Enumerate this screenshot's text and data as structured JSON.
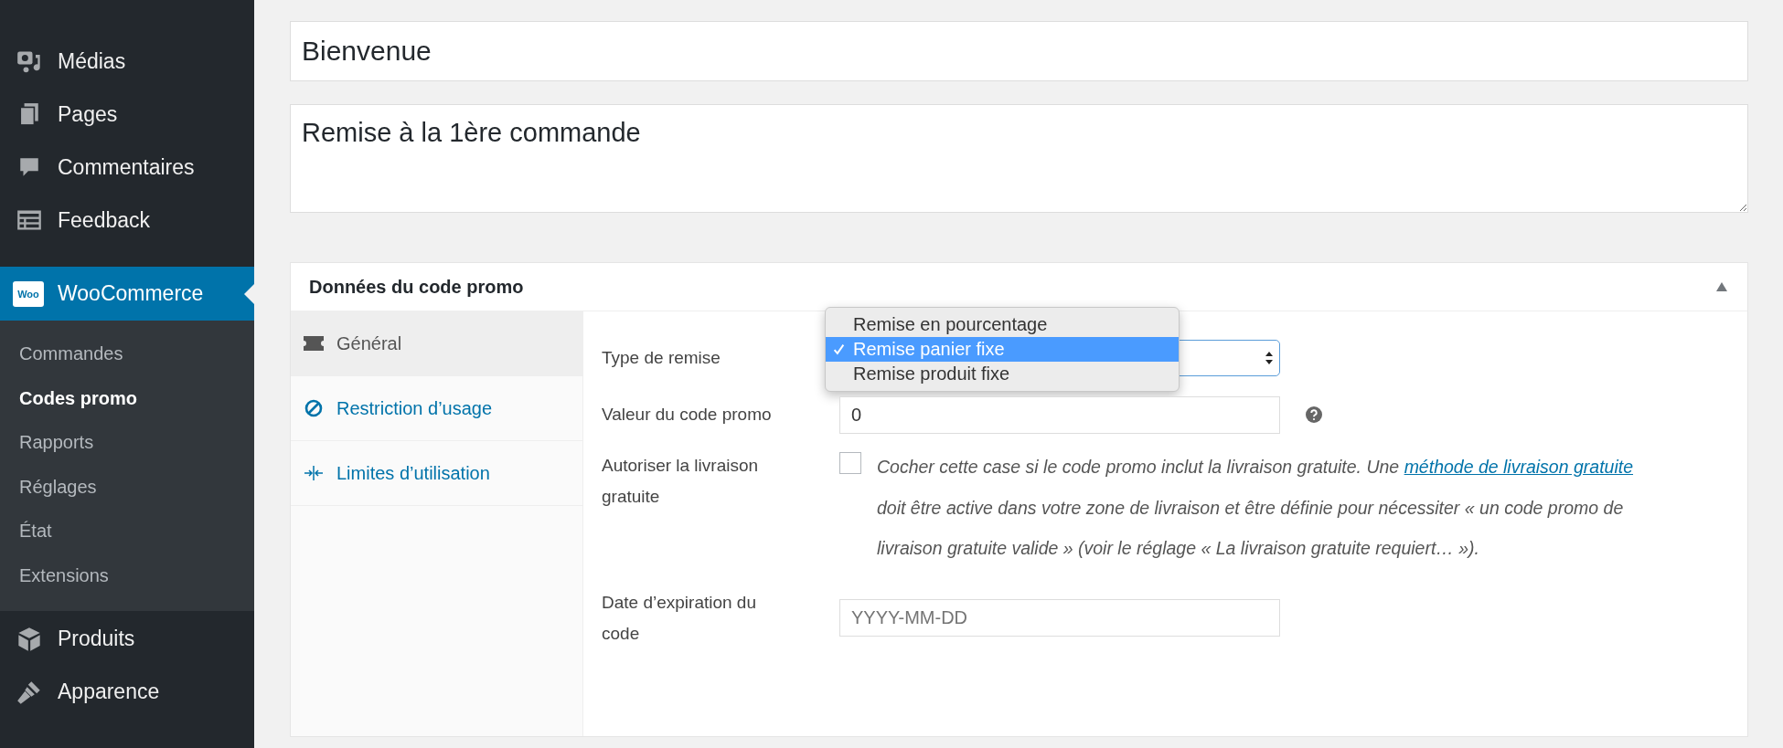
{
  "sidebar": {
    "items": [
      {
        "label": "Médias",
        "selected": false
      },
      {
        "label": "Pages",
        "selected": false
      },
      {
        "label": "Commentaires",
        "selected": false
      },
      {
        "label": "Feedback",
        "selected": false
      },
      {
        "label": "WooCommerce",
        "selected": true,
        "icon_text": "Woo",
        "children": [
          {
            "label": "Commandes",
            "selected": false
          },
          {
            "label": "Codes promo",
            "selected": true
          },
          {
            "label": "Rapports",
            "selected": false
          },
          {
            "label": "Réglages",
            "selected": false
          },
          {
            "label": "État",
            "selected": false
          },
          {
            "label": "Extensions",
            "selected": false
          }
        ]
      },
      {
        "label": "Produits",
        "selected": false
      },
      {
        "label": "Apparence",
        "selected": false
      }
    ]
  },
  "title_field": {
    "value": "Bienvenue"
  },
  "description_field": {
    "value": "Remise à la 1ère commande"
  },
  "panel": {
    "title": "Données du code promo",
    "expanded": true,
    "tabs": [
      {
        "label": "Général",
        "selected": true
      },
      {
        "label": "Restriction d’usage",
        "selected": false
      },
      {
        "label": "Limites d’utilisation",
        "selected": false
      }
    ],
    "fields": [
      {
        "kind": "select",
        "label": "Type de remise",
        "open": true,
        "options": [
          {
            "label": "Remise en pourcentage",
            "selected": false
          },
          {
            "label": "Remise panier fixe",
            "selected": true
          },
          {
            "label": "Remise produit fixe",
            "selected": false
          }
        ]
      },
      {
        "kind": "text",
        "label": "Valeur du code promo",
        "value": "0",
        "help": true
      },
      {
        "kind": "checkbox",
        "label": "Autoriser la livraison gratuite",
        "checked": false,
        "description": [
          {
            "text": "Cocher cette case si le code promo inclut la livraison gratuite. Une "
          },
          {
            "text": "méthode de livraison gratuite",
            "link": true
          },
          {
            "text": " doit être active dans votre zone de livraison et être définie pour nécessiter « un code promo de livraison gratuite valide » (voir le réglage « La livraison gratuite requiert… »)."
          }
        ]
      },
      {
        "kind": "text",
        "label": "Date d’expiration du code",
        "placeholder": "YYYY-MM-DD"
      }
    ]
  }
}
